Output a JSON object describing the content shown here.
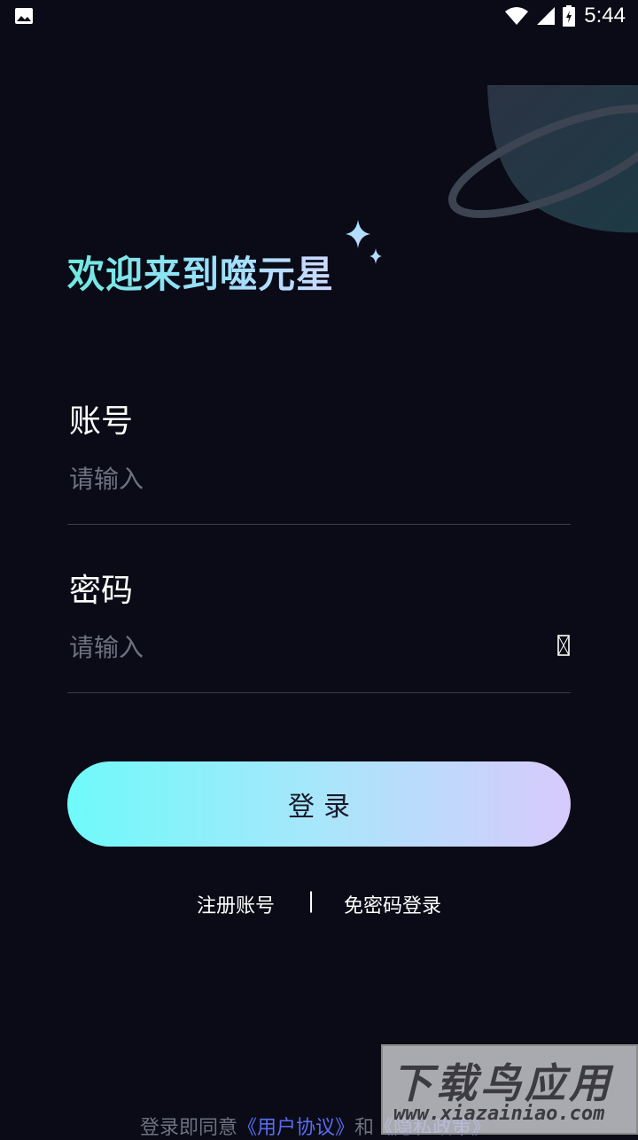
{
  "status_bar": {
    "time": "5:44",
    "icons": [
      "gallery-icon",
      "wifi-icon",
      "signal-icon",
      "battery-charging-icon"
    ]
  },
  "welcome": {
    "title": "欢迎来到噬元星"
  },
  "account": {
    "label": "账号",
    "placeholder": "请输入"
  },
  "password": {
    "label": "密码",
    "placeholder": "请输入",
    "toggle_icon": "eye-toggle-icon"
  },
  "login_button": {
    "label": "登录"
  },
  "links": {
    "register": "注册账号",
    "separator": "|",
    "passwordless": "免密码登录"
  },
  "agreement": {
    "prefix": "登录即同意",
    "user_agreement": "《用户协议》",
    "conjunction": "和",
    "privacy_policy": "《隐私政策》"
  },
  "watermark": {
    "title": "下载鸟应用",
    "url": "www.xiazainiao.com"
  },
  "colors": {
    "background": "#0a0b16",
    "title_gradient_start": "#6fe8df",
    "title_gradient_end": "#cfd9ff",
    "button_gradient_start": "#6ffafa",
    "button_gradient_end": "#d8cafc",
    "link_accent": "#5a6cf0",
    "placeholder": "#6e7180"
  }
}
